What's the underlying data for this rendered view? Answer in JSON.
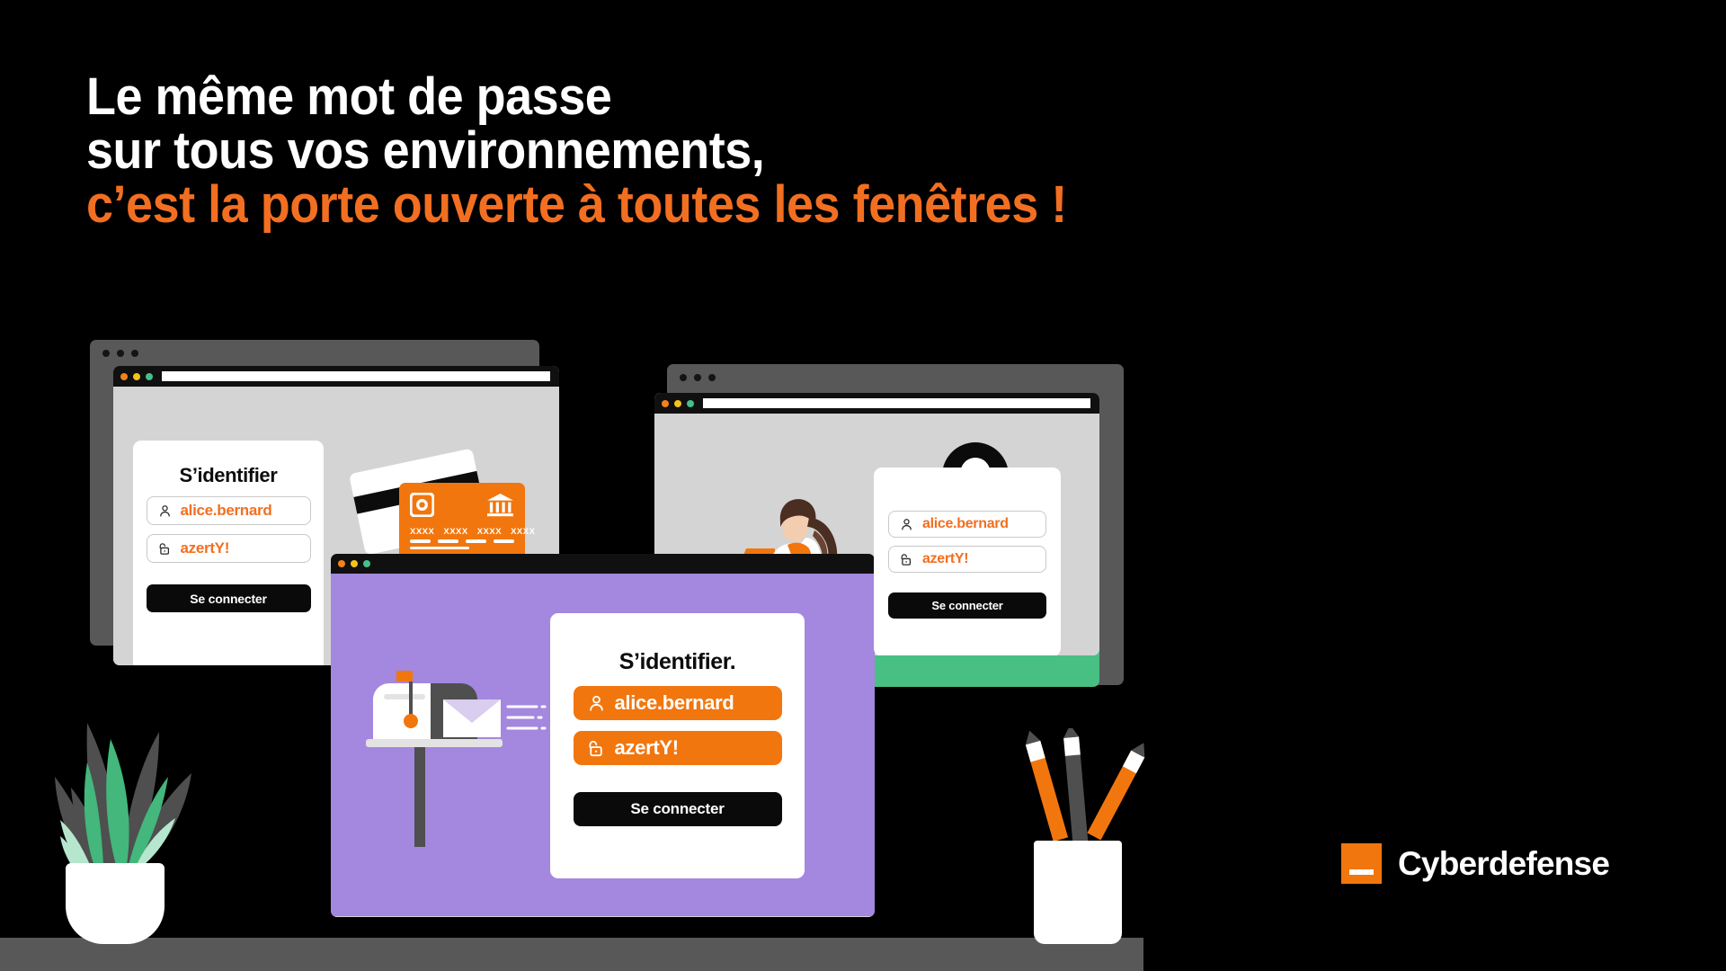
{
  "headline": {
    "line1": "Le même mot de passe",
    "line2": "sur tous vos environnements,",
    "line3": "c’est la porte ouverte à toutes les fenêtres !",
    "color_white": "#FFFFFF",
    "color_orange": "#F26F21"
  },
  "colors": {
    "background": "#000000",
    "orange": "#F26F21",
    "orange_fill": "#F2760E",
    "purple": "#A487DE",
    "green": "#49C083",
    "dark_gray": "#585858",
    "light_gray": "#D4D4D4",
    "black": "#0A0A0A",
    "white": "#FFFFFF"
  },
  "windows": [
    {
      "id": "bank",
      "traffic_lights": [
        "orange",
        "yellow",
        "green"
      ],
      "login": {
        "title": "S’identifier",
        "username_icon": "user-icon",
        "username_value": "alice.bernard",
        "password_icon": "open-padlock-icon",
        "password_value": "azertY!",
        "submit_label": "Se connecter"
      },
      "illustration": {
        "name": "credit-cards",
        "card_number": [
          "XXXX",
          "XXXX",
          "XXXX",
          "XXXX"
        ],
        "icons": [
          "chip-icon",
          "bank-icon"
        ]
      }
    },
    {
      "id": "corporate",
      "traffic_lights": [
        "orange",
        "yellow",
        "green"
      ],
      "login": {
        "title": "",
        "username_icon": "user-icon",
        "username_value": "alice.bernard",
        "password_icon": "open-padlock-icon",
        "password_value": "azertY!",
        "submit_label": "Se connecter"
      },
      "illustration": {
        "name": "woman-at-laptop",
        "avatar": "avatar-icon"
      }
    },
    {
      "id": "mail",
      "traffic_lights": [
        "orange",
        "yellow",
        "green"
      ],
      "login": {
        "title": "S’identifier.",
        "username_icon": "user-icon",
        "username_value": "alice.bernard",
        "password_icon": "open-padlock-icon",
        "password_value": "azertY!",
        "submit_label": "Se connecter"
      },
      "illustration": {
        "name": "mailbox-with-envelope"
      }
    }
  ],
  "decor": {
    "plant": "potted-snake-plant",
    "pencils": "pencil-cup",
    "shelf": "desk-shelf"
  },
  "logo": {
    "mark": "orange-square-mark",
    "name": "Cyberdefense"
  }
}
